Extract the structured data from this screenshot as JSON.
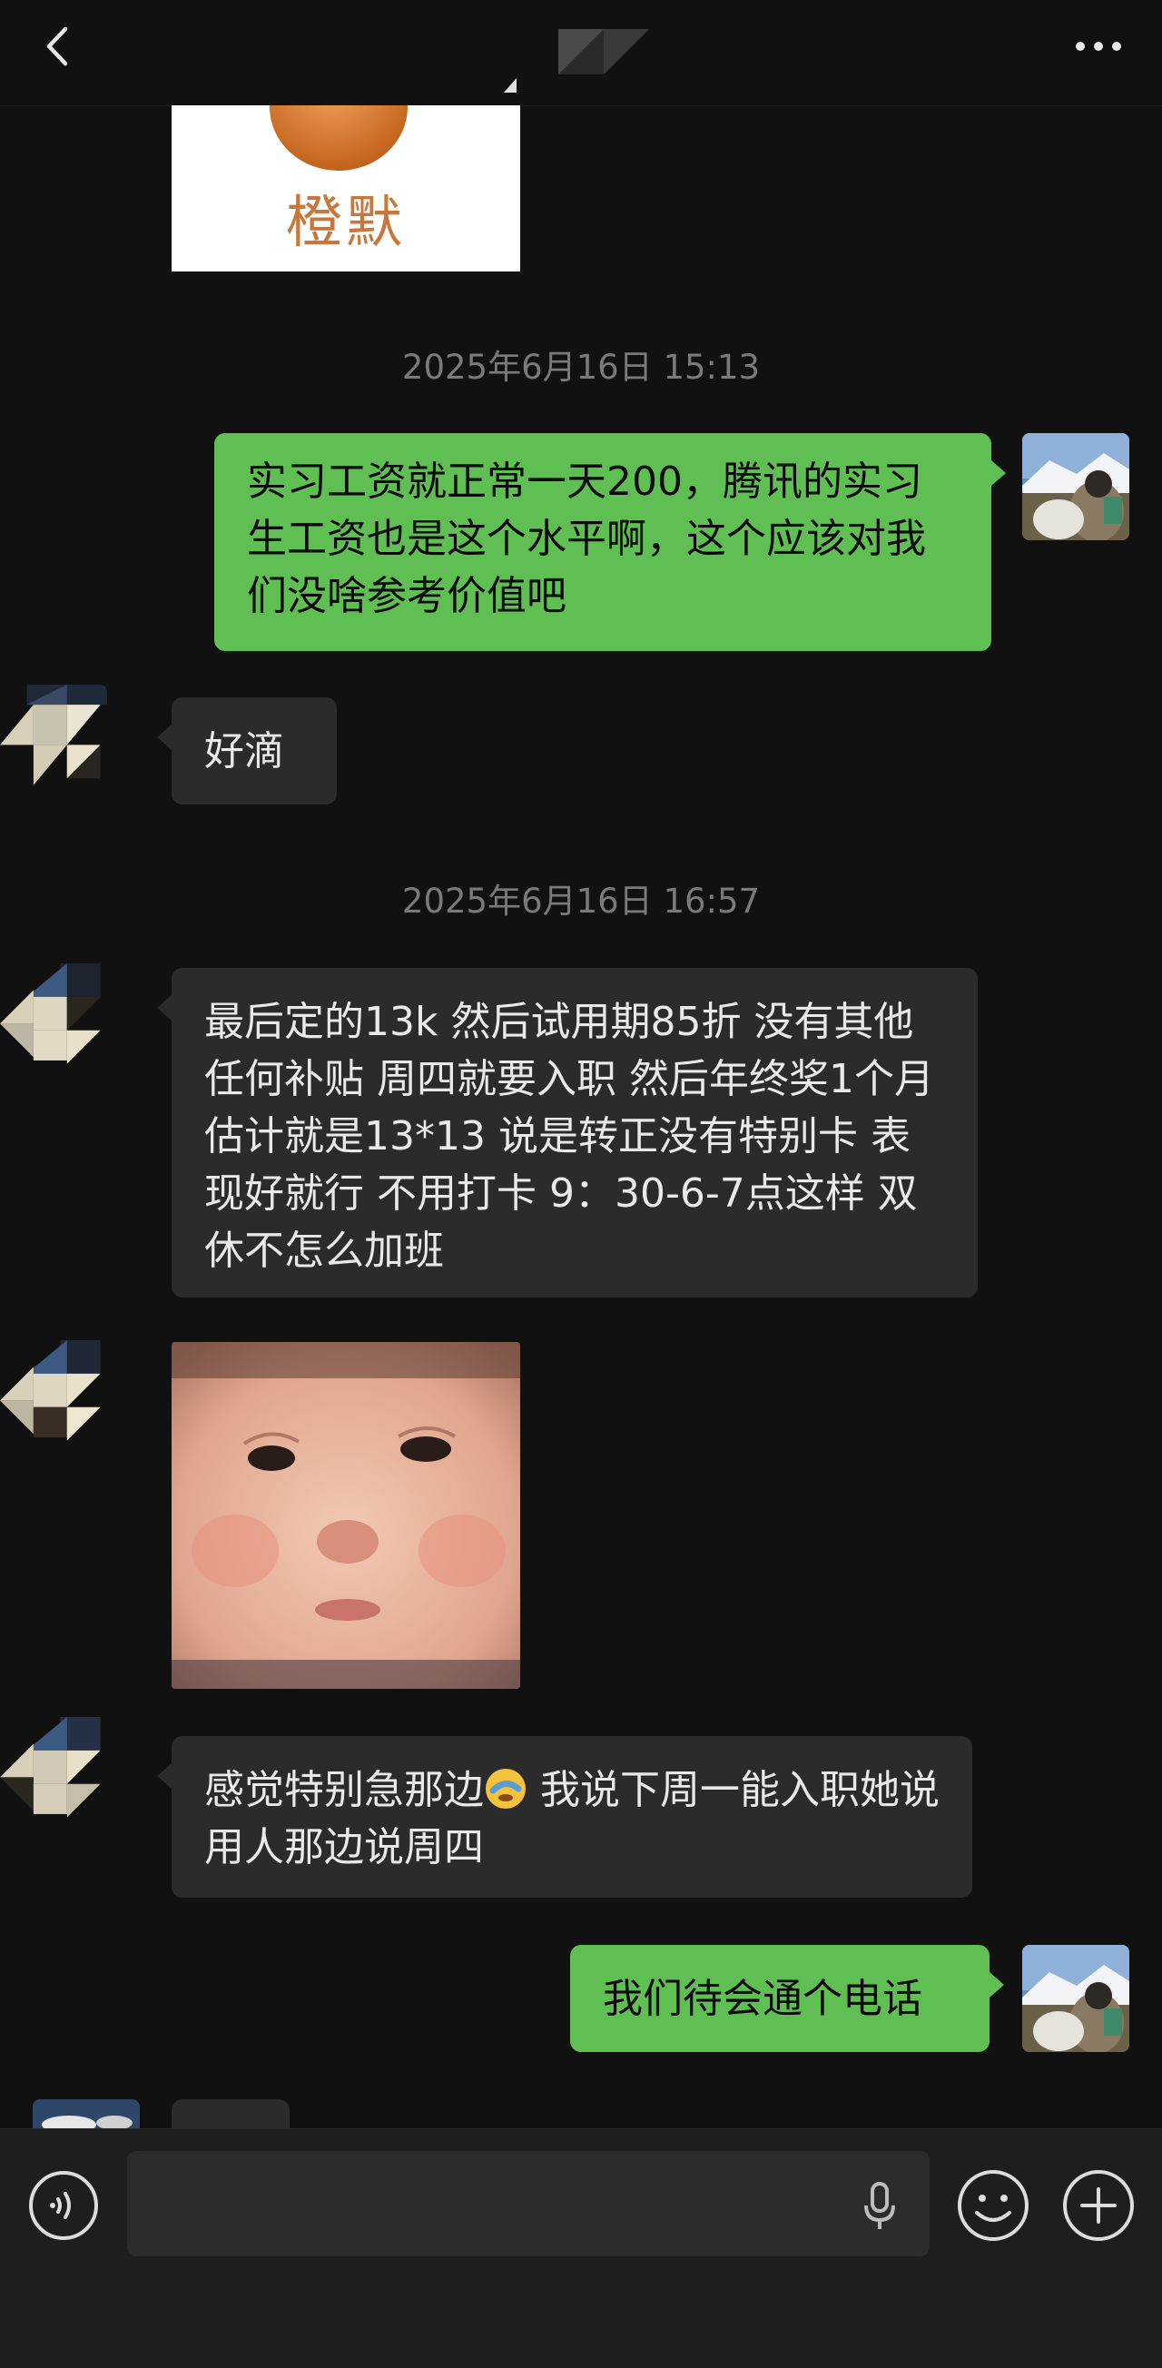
{
  "header": {
    "back_icon": "chevron-left-icon",
    "more_icon": "more-dots-icon"
  },
  "messages": {
    "sticker_top_text": "橙默",
    "ts1": "2025年6月16日 15:13",
    "out1": "实习工资就正常一天200，腾讯的实习生工资也是这个水平啊，这个应该对我们没啥参考价值吧",
    "in1": "好滴",
    "ts2": "2025年6月16日 16:57",
    "in2": "最后定的13k 然后试用期85折 没有其他任何补贴 周四就要入职 然后年终奖1个月 估计就是13*13 说是转正没有特别卡 表现好就行 不用打卡 9：30-6-7点这样 双休不怎么加班",
    "in3_a": "感觉特别急那边",
    "in3_b": " 我说下周一能入职她说用人那边说周四",
    "out2": "我们待会通个电话"
  },
  "colors": {
    "out_bubble": "#5fbf52",
    "in_bubble": "#2b2b2b",
    "bg": "#111111"
  },
  "input_bar": {
    "voice_icon": "voice-icon",
    "mic_icon": "microphone-icon",
    "emoji_icon": "emoji-icon",
    "plus_icon": "plus-icon"
  }
}
